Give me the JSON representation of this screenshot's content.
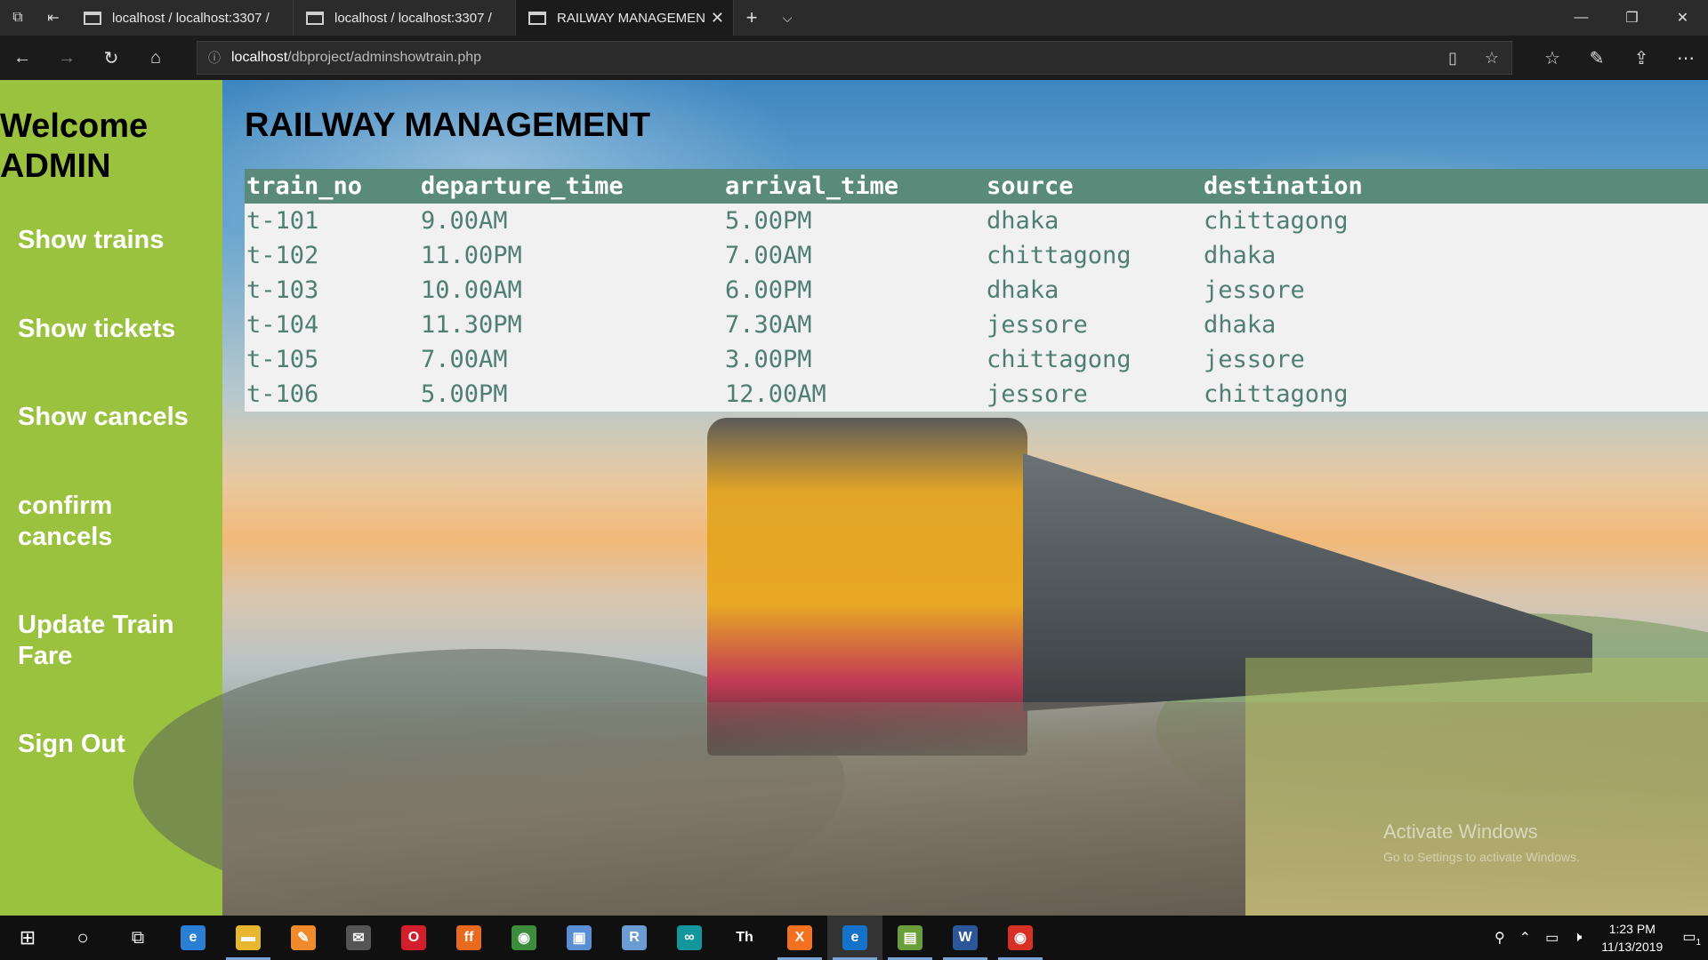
{
  "browser": {
    "tabs": [
      {
        "label": "localhost / localhost:3307 /",
        "active": false
      },
      {
        "label": "localhost / localhost:3307 /",
        "active": false
      },
      {
        "label": "RAILWAY MANAGEMEN",
        "active": true
      }
    ],
    "url_host": "localhost",
    "url_path": "/dbproject/adminshowtrain.php"
  },
  "sidebar": {
    "welcome": "Welcome ADMIN",
    "links": [
      "Show trains",
      "Show tickets",
      "Show cancels",
      "confirm cancels",
      "Update Train Fare",
      "Sign Out"
    ]
  },
  "main": {
    "title": "RAILWAY MANAGEMENT",
    "table": {
      "headers": [
        "train_no",
        "departure_time",
        "arrival_time",
        "source",
        "destination"
      ],
      "rows": [
        [
          "t-101",
          "9.00AM",
          "5.00PM",
          "dhaka",
          "chittagong"
        ],
        [
          "t-102",
          "11.00PM",
          "7.00AM",
          "chittagong",
          "dhaka"
        ],
        [
          "t-103",
          "10.00AM",
          "6.00PM",
          "dhaka",
          "jessore"
        ],
        [
          "t-104",
          "11.30PM",
          "7.30AM",
          "jessore",
          "dhaka"
        ],
        [
          "t-105",
          "7.00AM",
          "3.00PM",
          "chittagong",
          "jessore"
        ],
        [
          "t-106",
          "5.00PM",
          "12.00AM",
          "jessore",
          "chittagong"
        ]
      ]
    },
    "watermark": {
      "line1": "Activate Windows",
      "line2": "Go to Settings to activate Windows."
    }
  },
  "taskbar": {
    "apps": [
      {
        "icon": "edge-legacy-icon",
        "glyph": "e",
        "color": "#2a7fd4",
        "open": false
      },
      {
        "icon": "file-explorer-icon",
        "glyph": "▬",
        "color": "#e8b730",
        "open": true
      },
      {
        "icon": "paint-icon",
        "glyph": "✎",
        "color": "#f08a2a",
        "open": false
      },
      {
        "icon": "mail-icon",
        "glyph": "✉",
        "color": "#555555",
        "open": false
      },
      {
        "icon": "opera-icon",
        "glyph": "O",
        "color": "#d21f2b",
        "open": false
      },
      {
        "icon": "firefox-icon",
        "glyph": "ff",
        "color": "#e86a1e",
        "open": false
      },
      {
        "icon": "chrome-icon",
        "glyph": "◉",
        "color": "#3b8c3b",
        "open": false
      },
      {
        "icon": "virtualbox-icon",
        "glyph": "▣",
        "color": "#5a8fd6",
        "open": false
      },
      {
        "icon": "r-icon",
        "glyph": "R",
        "color": "#6a9bd1",
        "open": false
      },
      {
        "icon": "arduino-icon",
        "glyph": "∞",
        "color": "#14979c",
        "open": false
      },
      {
        "icon": "typora-icon",
        "glyph": "Th",
        "color": "#101010",
        "open": false
      },
      {
        "icon": "xampp-icon",
        "glyph": "X",
        "color": "#f37021",
        "open": true
      },
      {
        "icon": "edge-icon",
        "glyph": "e",
        "color": "#1473c9",
        "open": true,
        "active": true
      },
      {
        "icon": "notepad-icon",
        "glyph": "▤",
        "color": "#6b9e3a",
        "open": true
      },
      {
        "icon": "word-icon",
        "glyph": "W",
        "color": "#2b579a",
        "open": true
      },
      {
        "icon": "chrome-icon",
        "glyph": "◉",
        "color": "#d93025",
        "open": true
      }
    ],
    "time": "1:23 PM",
    "date": "11/13/2019",
    "notification_count": "1"
  }
}
